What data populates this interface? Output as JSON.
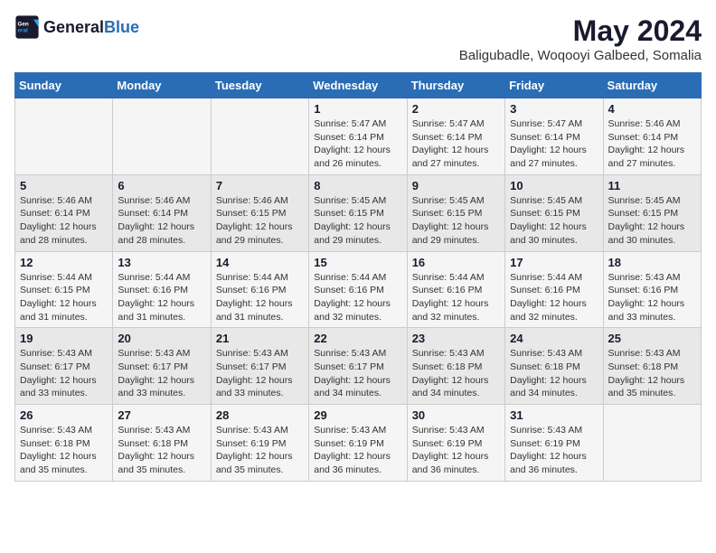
{
  "header": {
    "logo_general": "General",
    "logo_blue": "Blue",
    "title": "May 2024",
    "subtitle": "Baligubadle, Woqooyi Galbeed, Somalia"
  },
  "weekdays": [
    "Sunday",
    "Monday",
    "Tuesday",
    "Wednesday",
    "Thursday",
    "Friday",
    "Saturday"
  ],
  "weeks": [
    [
      {
        "day": "",
        "info": ""
      },
      {
        "day": "",
        "info": ""
      },
      {
        "day": "",
        "info": ""
      },
      {
        "day": "1",
        "info": "Sunrise: 5:47 AM\nSunset: 6:14 PM\nDaylight: 12 hours and 26 minutes."
      },
      {
        "day": "2",
        "info": "Sunrise: 5:47 AM\nSunset: 6:14 PM\nDaylight: 12 hours and 27 minutes."
      },
      {
        "day": "3",
        "info": "Sunrise: 5:47 AM\nSunset: 6:14 PM\nDaylight: 12 hours and 27 minutes."
      },
      {
        "day": "4",
        "info": "Sunrise: 5:46 AM\nSunset: 6:14 PM\nDaylight: 12 hours and 27 minutes."
      }
    ],
    [
      {
        "day": "5",
        "info": "Sunrise: 5:46 AM\nSunset: 6:14 PM\nDaylight: 12 hours and 28 minutes."
      },
      {
        "day": "6",
        "info": "Sunrise: 5:46 AM\nSunset: 6:14 PM\nDaylight: 12 hours and 28 minutes."
      },
      {
        "day": "7",
        "info": "Sunrise: 5:46 AM\nSunset: 6:15 PM\nDaylight: 12 hours and 29 minutes."
      },
      {
        "day": "8",
        "info": "Sunrise: 5:45 AM\nSunset: 6:15 PM\nDaylight: 12 hours and 29 minutes."
      },
      {
        "day": "9",
        "info": "Sunrise: 5:45 AM\nSunset: 6:15 PM\nDaylight: 12 hours and 29 minutes."
      },
      {
        "day": "10",
        "info": "Sunrise: 5:45 AM\nSunset: 6:15 PM\nDaylight: 12 hours and 30 minutes."
      },
      {
        "day": "11",
        "info": "Sunrise: 5:45 AM\nSunset: 6:15 PM\nDaylight: 12 hours and 30 minutes."
      }
    ],
    [
      {
        "day": "12",
        "info": "Sunrise: 5:44 AM\nSunset: 6:15 PM\nDaylight: 12 hours and 31 minutes."
      },
      {
        "day": "13",
        "info": "Sunrise: 5:44 AM\nSunset: 6:16 PM\nDaylight: 12 hours and 31 minutes."
      },
      {
        "day": "14",
        "info": "Sunrise: 5:44 AM\nSunset: 6:16 PM\nDaylight: 12 hours and 31 minutes."
      },
      {
        "day": "15",
        "info": "Sunrise: 5:44 AM\nSunset: 6:16 PM\nDaylight: 12 hours and 32 minutes."
      },
      {
        "day": "16",
        "info": "Sunrise: 5:44 AM\nSunset: 6:16 PM\nDaylight: 12 hours and 32 minutes."
      },
      {
        "day": "17",
        "info": "Sunrise: 5:44 AM\nSunset: 6:16 PM\nDaylight: 12 hours and 32 minutes."
      },
      {
        "day": "18",
        "info": "Sunrise: 5:43 AM\nSunset: 6:16 PM\nDaylight: 12 hours and 33 minutes."
      }
    ],
    [
      {
        "day": "19",
        "info": "Sunrise: 5:43 AM\nSunset: 6:17 PM\nDaylight: 12 hours and 33 minutes."
      },
      {
        "day": "20",
        "info": "Sunrise: 5:43 AM\nSunset: 6:17 PM\nDaylight: 12 hours and 33 minutes."
      },
      {
        "day": "21",
        "info": "Sunrise: 5:43 AM\nSunset: 6:17 PM\nDaylight: 12 hours and 33 minutes."
      },
      {
        "day": "22",
        "info": "Sunrise: 5:43 AM\nSunset: 6:17 PM\nDaylight: 12 hours and 34 minutes."
      },
      {
        "day": "23",
        "info": "Sunrise: 5:43 AM\nSunset: 6:18 PM\nDaylight: 12 hours and 34 minutes."
      },
      {
        "day": "24",
        "info": "Sunrise: 5:43 AM\nSunset: 6:18 PM\nDaylight: 12 hours and 34 minutes."
      },
      {
        "day": "25",
        "info": "Sunrise: 5:43 AM\nSunset: 6:18 PM\nDaylight: 12 hours and 35 minutes."
      }
    ],
    [
      {
        "day": "26",
        "info": "Sunrise: 5:43 AM\nSunset: 6:18 PM\nDaylight: 12 hours and 35 minutes."
      },
      {
        "day": "27",
        "info": "Sunrise: 5:43 AM\nSunset: 6:18 PM\nDaylight: 12 hours and 35 minutes."
      },
      {
        "day": "28",
        "info": "Sunrise: 5:43 AM\nSunset: 6:19 PM\nDaylight: 12 hours and 35 minutes."
      },
      {
        "day": "29",
        "info": "Sunrise: 5:43 AM\nSunset: 6:19 PM\nDaylight: 12 hours and 36 minutes."
      },
      {
        "day": "30",
        "info": "Sunrise: 5:43 AM\nSunset: 6:19 PM\nDaylight: 12 hours and 36 minutes."
      },
      {
        "day": "31",
        "info": "Sunrise: 5:43 AM\nSunset: 6:19 PM\nDaylight: 12 hours and 36 minutes."
      },
      {
        "day": "",
        "info": ""
      }
    ]
  ]
}
